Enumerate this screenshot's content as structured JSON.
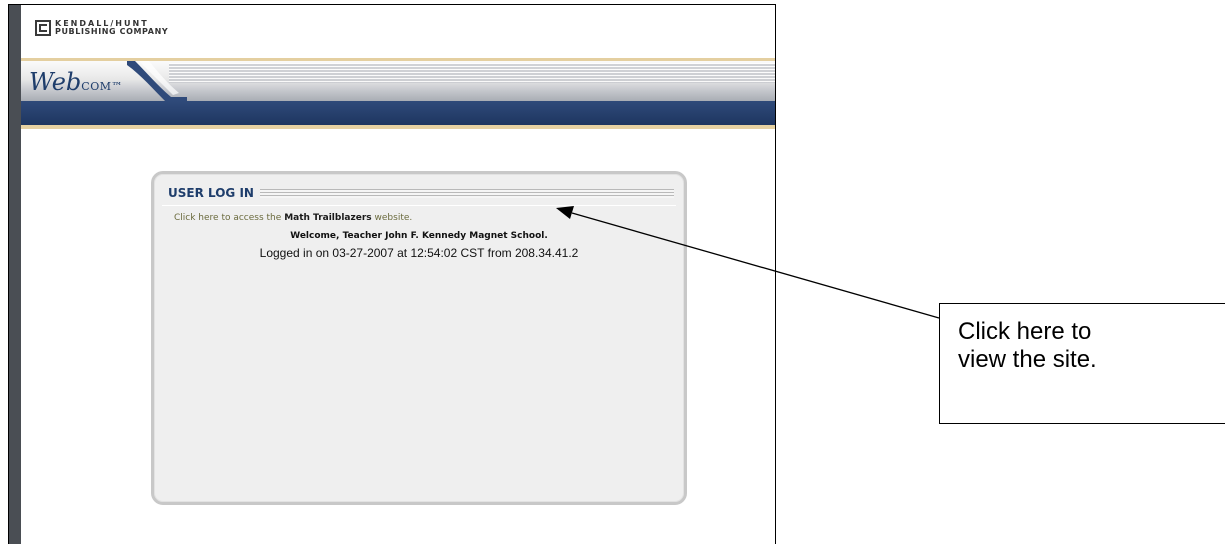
{
  "publisher": {
    "line1": "KENDALL/HUNT",
    "line2": "PUBLISHING COMPANY"
  },
  "brand": {
    "name": "Web",
    "suffix": "COM",
    "tm": "™"
  },
  "login_panel": {
    "title": "USER LOG IN",
    "access_prefix": "Click here to access the",
    "access_link": "Math Trailblazers",
    "access_suffix": "website.",
    "welcome": "Welcome, Teacher John F. Kennedy Magnet School.",
    "logged_in": "Logged in on 03-27-2007 at 12:54:02 CST from 208.34.41.2"
  },
  "annotation": {
    "text_line1": "Click here to",
    "text_line2": "view the site."
  },
  "colors": {
    "brand_navy": "#1e3d6b",
    "accent_tan": "#e5d1a2",
    "panel_bg": "#efefef"
  }
}
